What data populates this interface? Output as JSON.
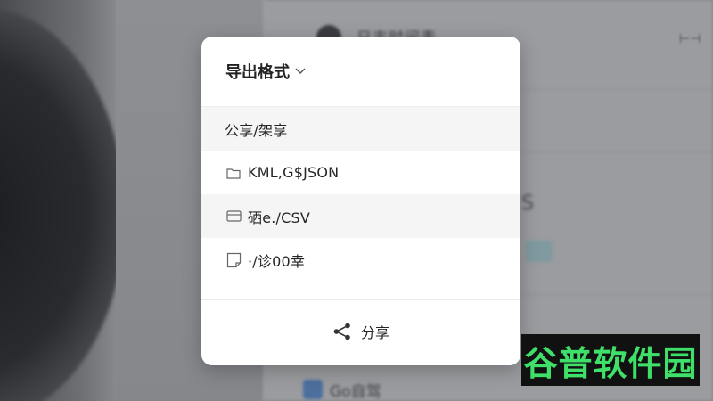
{
  "background": {
    "title": "日志时间表",
    "bottom_button": "Go自驾"
  },
  "modal": {
    "title": "导出格式",
    "options": [
      {
        "label": "公享/架享",
        "icon": "none"
      },
      {
        "label": "KML,G$JSON",
        "icon": "folder-icon"
      },
      {
        "label": "硒e./CSV",
        "icon": "card-icon"
      },
      {
        "label": "·/诊00幸",
        "icon": "note-icon"
      }
    ],
    "share_label": "分享"
  },
  "watermark": {
    "text": "谷普软件园",
    "color": "#3fe06a"
  }
}
